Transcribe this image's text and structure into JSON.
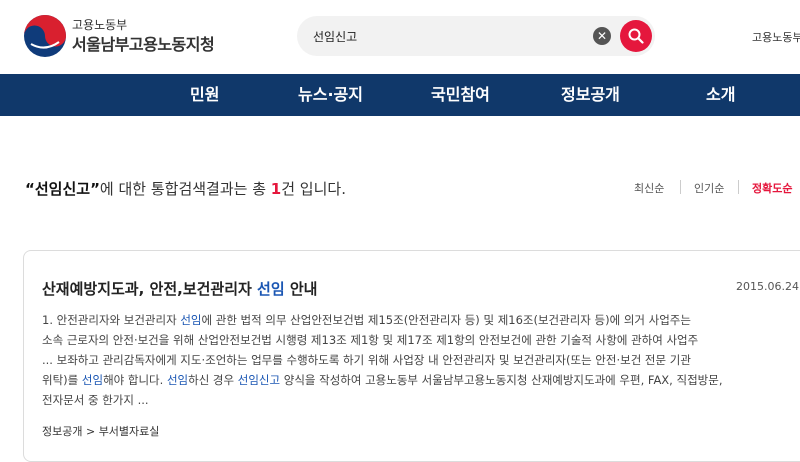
{
  "header": {
    "org_small": "고용노동부",
    "org_name": "서울남부고용노동지청",
    "search_value": "선임신고",
    "right_link": "고용노동부"
  },
  "nav": {
    "items": [
      "민원",
      "뉴스·공지",
      "국민참여",
      "정보공개",
      "소개"
    ]
  },
  "summary": {
    "open_quote": "“",
    "query": "선임신고",
    "close_quote": "”",
    "text_before_count": "에 대한 통합검색결과는 총 ",
    "count": "1",
    "text_after_count": "건 입니다."
  },
  "sort": {
    "options": [
      "최신순",
      "인기순",
      "정확도순"
    ],
    "active": "정확도순"
  },
  "result": {
    "title_part1": "산재예방지도과, 안전,보건관리자 ",
    "title_highlight": "선임",
    "title_part2": " 안내",
    "date": "2015.06.24",
    "line1_a": "1. 안전관리자와 보건관리자 ",
    "line1_hl": "선임",
    "line1_b": "에 관한 법적 의무 산업안전보건법 제15조(안전관리자 등) 및 제16조(보건관리자 등)에 의거 사업주는",
    "line2": "소속 근로자의 안전·보건을 위해 산업안전보건법 시행령 제13조 제1항 및 제17조 제1항의 안전보건에 관한 기술적 사항에 관하여 사업주",
    "line3": "... 보좌하고 관리감독자에게 지도·조언하는 업무를 수행하도록 하기 위해 사업장 내 안전관리자 및 보건관리자(또는 안전·보건 전문 기관",
    "line4_a": "위탁)를 ",
    "line4_hl1": "선임",
    "line4_b": "해야 합니다. ",
    "line4_hl2": "선임",
    "line4_c": "하신 경우 ",
    "line4_hl3": "선임신고",
    "line4_d": " 양식을 작성하여 고용노동부 서울남부고용노동지청 산재예방지도과에 우편, FAX, 직접방문,",
    "line5": "전자문서 중 한가지 ...",
    "breadcrumb": "정보공개 > 부서별자료실"
  }
}
